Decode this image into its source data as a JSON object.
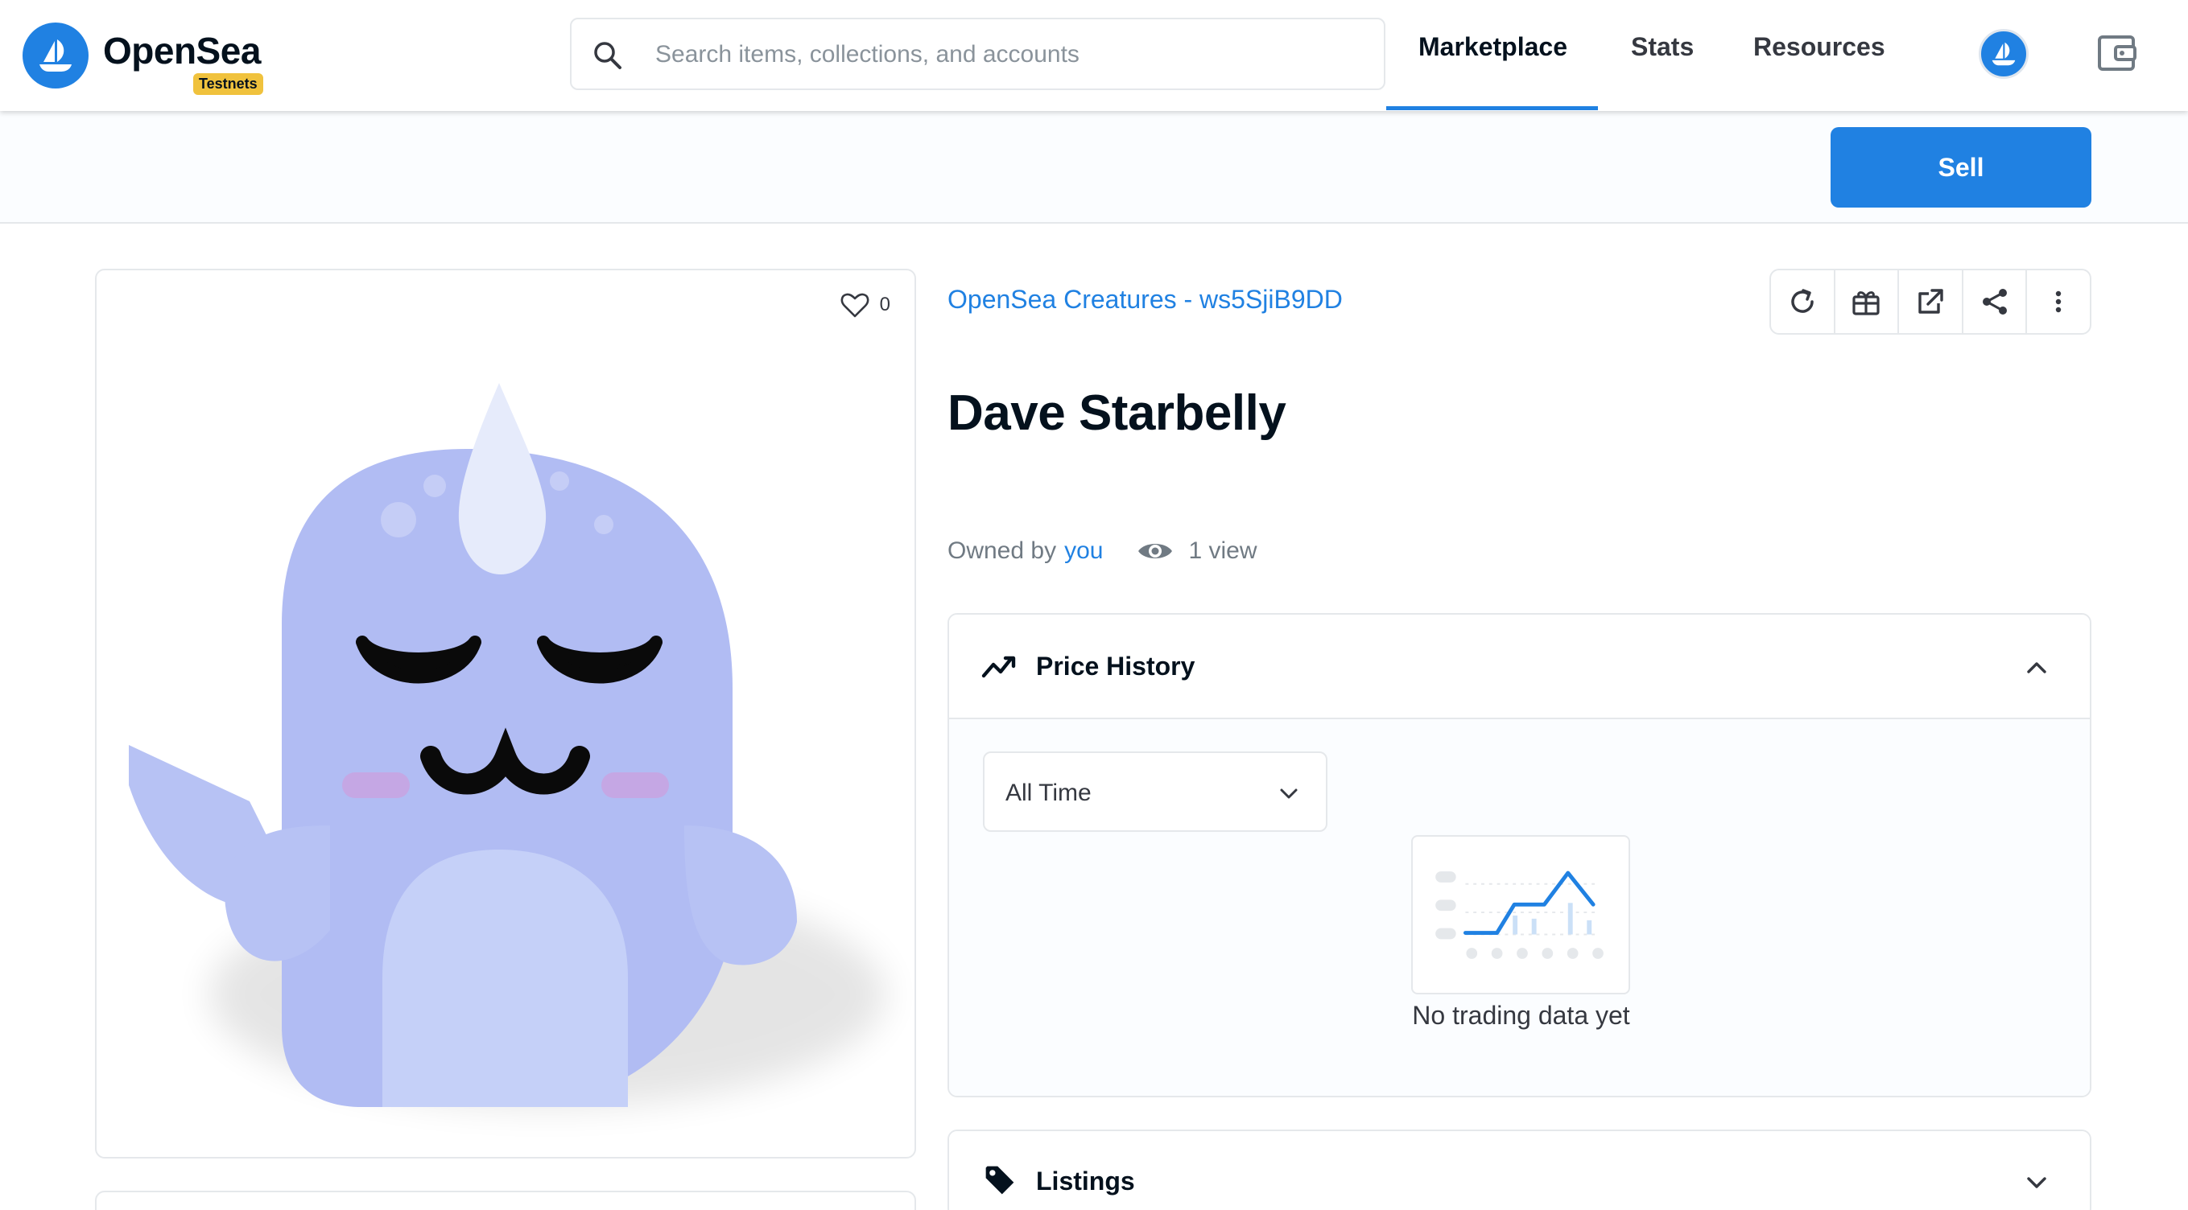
{
  "brand": {
    "name": "OpenSea",
    "badge": "Testnets",
    "color": "#2081e2"
  },
  "search": {
    "placeholder": "Search items, collections, and accounts",
    "value": ""
  },
  "nav": {
    "items": [
      {
        "label": "Marketplace",
        "active": true
      },
      {
        "label": "Stats",
        "active": false
      },
      {
        "label": "Resources",
        "active": false
      }
    ],
    "icons": [
      "profile-avatar-icon",
      "wallet-icon"
    ]
  },
  "subbar": {
    "sell_label": "Sell"
  },
  "media": {
    "favorites_count": "0",
    "favorite_icon": "heart-icon",
    "image_subject": "narwhal-creature"
  },
  "item": {
    "collection": "OpenSea Creatures - ws5SjiB9DD",
    "title": "Dave Starbelly",
    "owned_by_label": "Owned by",
    "owner": "you",
    "views": "1 view",
    "actions": [
      "refresh-icon",
      "gift-icon",
      "external-link-icon",
      "share-icon",
      "more-vertical-icon"
    ]
  },
  "price_history": {
    "title": "Price History",
    "icon": "trend-line-icon",
    "expanded": true,
    "time_filter": "All Time",
    "empty_text": "No trading data yet"
  },
  "listings": {
    "title": "Listings",
    "icon": "tag-icon",
    "expanded": false
  }
}
